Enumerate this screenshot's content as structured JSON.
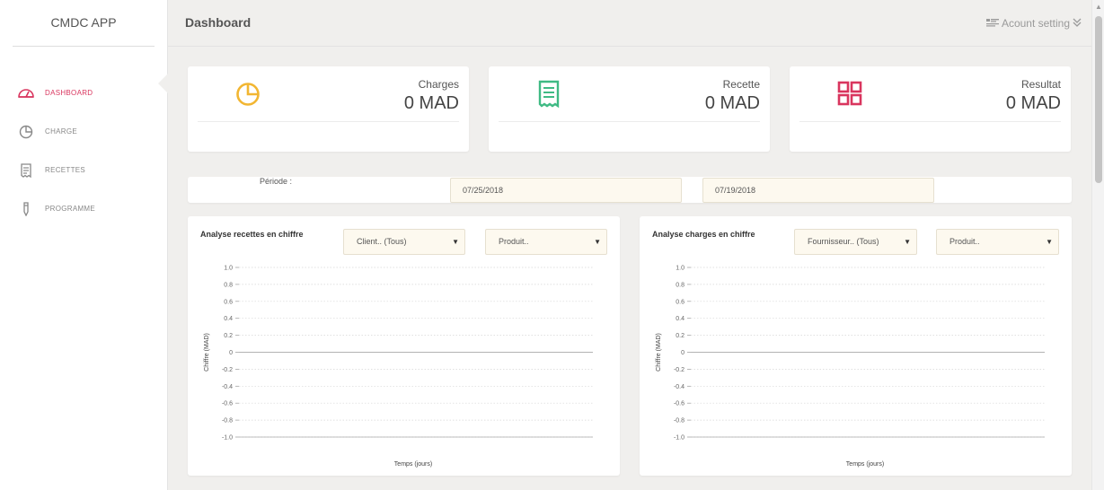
{
  "app": {
    "brand": "CMDC APP",
    "page_title": "Dashboard",
    "account_label": "Acount setting"
  },
  "sidebar": {
    "items": [
      {
        "label": "DASHBOARD",
        "icon": "dashboard-gauge-icon",
        "active": true
      },
      {
        "label": "CHARGE",
        "icon": "pie-chart-icon",
        "active": false
      },
      {
        "label": "RECETTES",
        "icon": "receipt-icon",
        "active": false
      },
      {
        "label": "PROGRAMME",
        "icon": "pencil-icon",
        "active": false
      }
    ]
  },
  "stats": [
    {
      "label": "Charges",
      "value": "0 MAD",
      "icon": "pie-chart-icon",
      "color": "#f2b632"
    },
    {
      "label": "Recette",
      "value": "0 MAD",
      "icon": "receipt-icon",
      "color": "#3fba84"
    },
    {
      "label": "Resultat",
      "value": "0 MAD",
      "icon": "grid-icon",
      "color": "#d9355e"
    }
  ],
  "period": {
    "label": "Période :",
    "date_from": "07/25/2018",
    "date_to": "07/19/2018"
  },
  "colors": {
    "accent": "#d9355e",
    "input_bg": "#fdf9ef"
  },
  "charts": {
    "recettes": {
      "title": "Analyse recettes en chiffre",
      "select1": "Client.. (Tous)",
      "select2": "Produit.."
    },
    "charges": {
      "title": "Analyse charges en chiffre",
      "select1": "Fournisseur.. (Tous)",
      "select2": "Produit.."
    }
  },
  "chart_data": [
    {
      "type": "line",
      "title": "Analyse recettes en chiffre",
      "xlabel": "Temps (jours)",
      "ylabel": "Chiffre (MAD)",
      "ylim": [
        -1.0,
        1.0
      ],
      "yticks": [
        "1.0",
        "0.8",
        "0.6",
        "0.4",
        "0.2",
        "0",
        "-0.2",
        "-0.4",
        "-0.6",
        "-0.8",
        "-1.0"
      ],
      "series": [],
      "grid": true
    },
    {
      "type": "line",
      "title": "Analyse charges en chiffre",
      "xlabel": "Temps (jours)",
      "ylabel": "Chiffre (MAD)",
      "ylim": [
        -1.0,
        1.0
      ],
      "yticks": [
        "1.0",
        "0.8",
        "0.6",
        "0.4",
        "0.2",
        "0",
        "-0.2",
        "-0.4",
        "-0.6",
        "-0.8",
        "-1.0"
      ],
      "series": [],
      "grid": true
    }
  ]
}
